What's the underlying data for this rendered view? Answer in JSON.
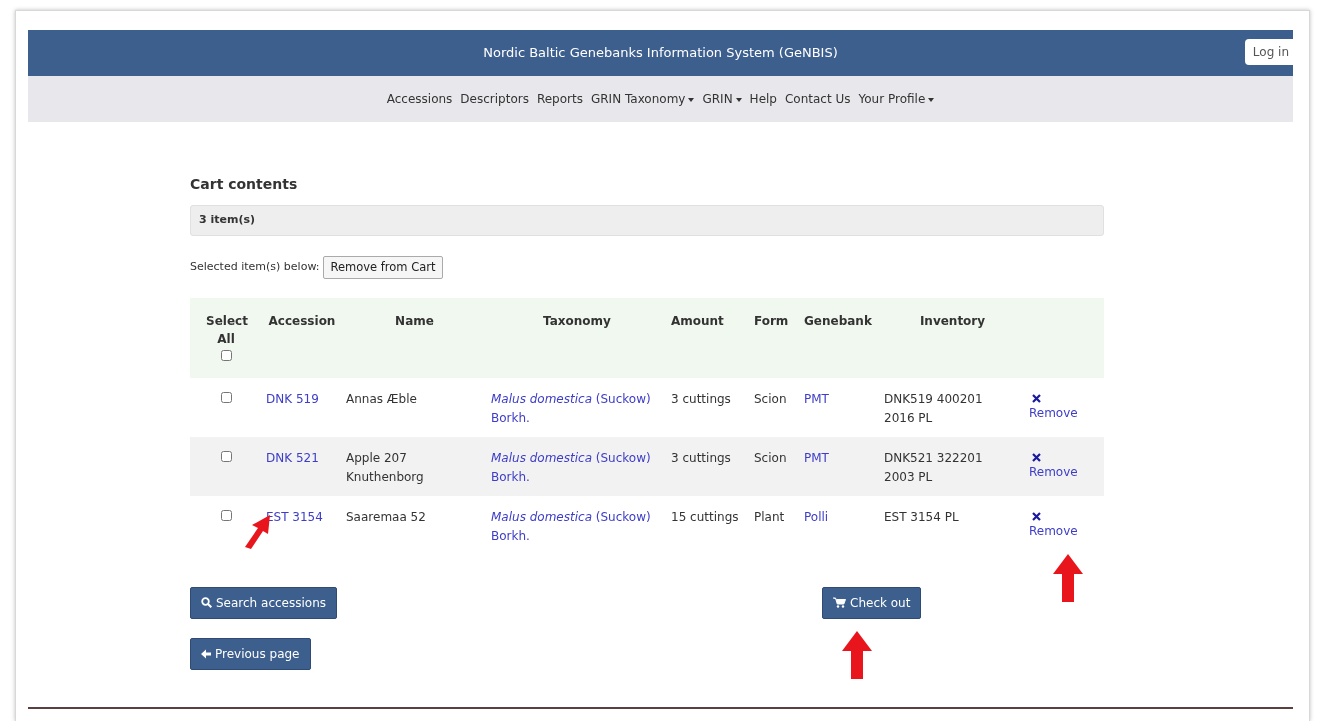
{
  "header": {
    "title": "Nordic Baltic Genebanks Information System (GeNBIS)",
    "login": "Log in"
  },
  "nav": [
    {
      "label": "Accessions",
      "dropdown": false
    },
    {
      "label": "Descriptors",
      "dropdown": false
    },
    {
      "label": "Reports",
      "dropdown": false
    },
    {
      "label": "GRIN Taxonomy",
      "dropdown": true
    },
    {
      "label": "GRIN",
      "dropdown": true
    },
    {
      "label": "Help",
      "dropdown": false
    },
    {
      "label": "Contact Us",
      "dropdown": false
    },
    {
      "label": "Your Profile",
      "dropdown": true
    }
  ],
  "heading": "Cart contents",
  "count": "3 item(s)",
  "selected_label": "Selected item(s) below:",
  "remove_from_cart": "Remove from Cart",
  "table": {
    "columns": [
      "Select All",
      "Accession",
      "Name",
      "Taxonomy",
      "Amount",
      "Form",
      "Genebank",
      "Inventory"
    ],
    "select_all_checked": false,
    "rows": [
      {
        "checked": false,
        "accession": "DNK 519",
        "name": "Annas Æble",
        "taxonomy": "*Malus domestica* (Suckow) Borkh.",
        "amount": "3 cuttings",
        "form": "Scion",
        "genebank": "PMT",
        "inventory": "DNK519 400201 2016 PL",
        "remove": "Remove"
      },
      {
        "checked": false,
        "accession": "DNK 521",
        "name": "Apple 207 Knuthenborg",
        "taxonomy": "*Malus domestica* (Suckow) Borkh.",
        "amount": "3 cuttings",
        "form": "Scion",
        "genebank": "PMT",
        "inventory": "DNK521 322201 2003 PL",
        "remove": "Remove"
      },
      {
        "checked": false,
        "accession": "EST 3154",
        "name": "Saaremaa 52",
        "taxonomy": "*Malus domestica* (Suckow) Borkh.",
        "amount": "15 cuttings",
        "form": "Plant",
        "genebank": "Polli",
        "inventory": "EST 3154 PL",
        "remove": "Remove"
      }
    ]
  },
  "buttons": {
    "search": "Search accessions",
    "checkout": "Check out",
    "previous": "Previous page"
  }
}
